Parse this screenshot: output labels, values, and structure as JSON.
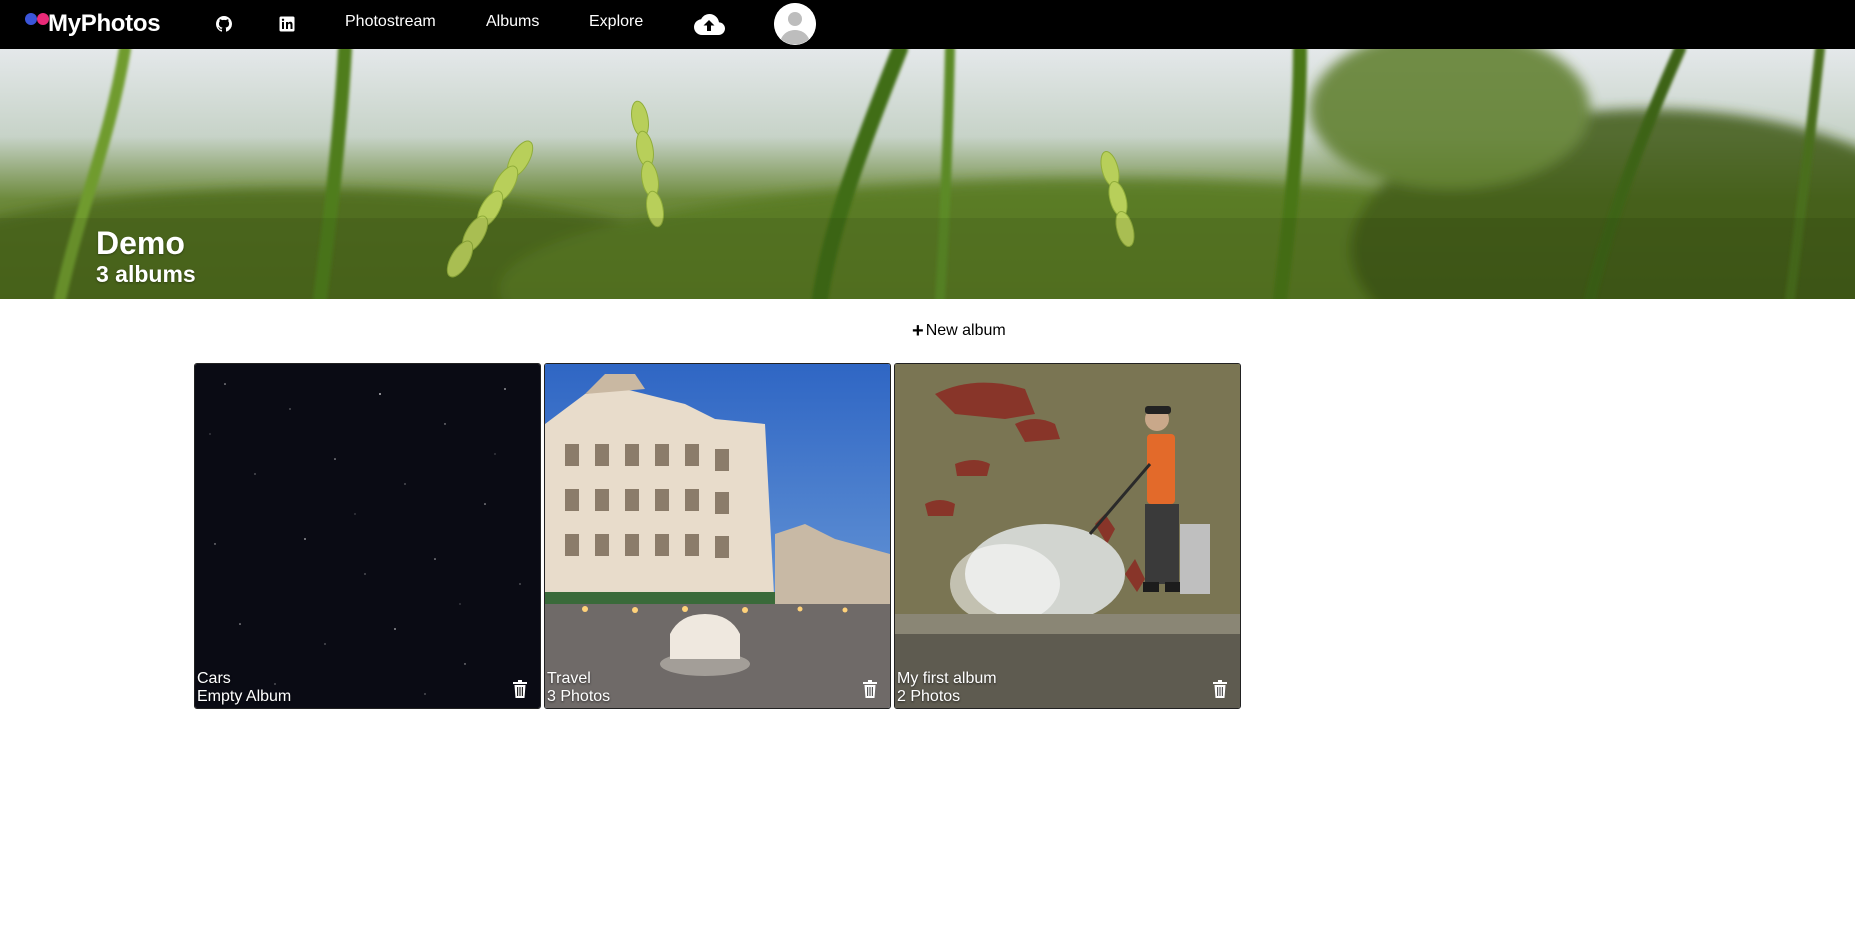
{
  "brand": {
    "name": "MyPhotos",
    "colors": {
      "dot_left": "#3b55d9",
      "dot_right": "#ea2a78"
    }
  },
  "nav": {
    "icons": {
      "github": "github-icon",
      "linkedin": "linkedin-icon",
      "upload": "cloud-upload-icon"
    },
    "links": [
      "Photostream",
      "Albums",
      "Explore"
    ]
  },
  "hero": {
    "user_name": "Demo",
    "album_count": "3 albums"
  },
  "actions": {
    "new_album_icon": "+",
    "new_album_label": "New album"
  },
  "albums": [
    {
      "name": "Cars",
      "photo_count": "Empty Album",
      "thumbnail": "starry-night-sky"
    },
    {
      "name": "Travel",
      "photo_count": "3 Photos",
      "thumbnail": "city-street-building"
    },
    {
      "name": "My first album",
      "photo_count": "2 Photos",
      "thumbnail": "street-art-mural"
    }
  ]
}
